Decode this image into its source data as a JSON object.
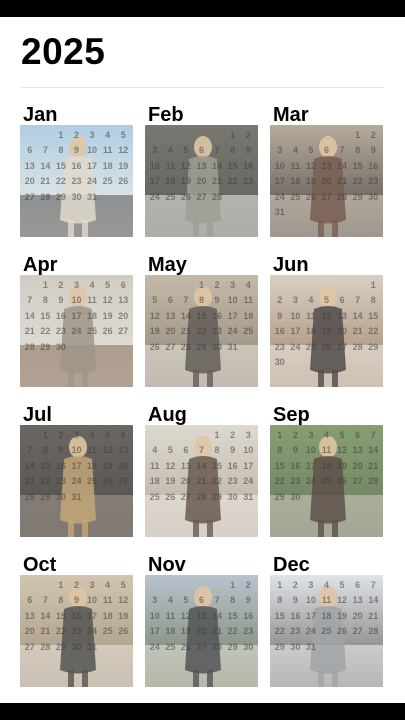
{
  "header": {
    "year": "2025"
  },
  "months": [
    {
      "name": "Jan",
      "offset": 2,
      "days": 31,
      "colors": [
        "#9fc3dc",
        "#d9d1c2",
        "#2a2a2a",
        "#f0ece4"
      ]
    },
    {
      "name": "Feb",
      "offset": 5,
      "days": 28,
      "colors": [
        "#5b5a52",
        "#8b8a7c",
        "#efece6",
        "#3b3a35"
      ]
    },
    {
      "name": "Mar",
      "offset": 5,
      "days": 31,
      "colors": [
        "#a69a88",
        "#5b3b2c",
        "#d9cdbb",
        "#2d2420"
      ]
    },
    {
      "name": "Apr",
      "offset": 1,
      "days": 30,
      "colors": [
        "#c7c2b6",
        "#8a7e6e",
        "#6e4b32",
        "#e0ddd5"
      ]
    },
    {
      "name": "May",
      "offset": 3,
      "days": 31,
      "colors": [
        "#b7aa95",
        "#3f3a34",
        "#e7e2d8",
        "#7a6d5c"
      ]
    },
    {
      "name": "Jun",
      "offset": 6,
      "days": 30,
      "colors": [
        "#cfc6b6",
        "#2b2623",
        "#f1efe9",
        "#8f6b4c"
      ]
    },
    {
      "name": "Jul",
      "offset": 1,
      "days": 31,
      "colors": [
        "#4b4640",
        "#b7935c",
        "#8f8778",
        "#2e2a26"
      ]
    },
    {
      "name": "Aug",
      "offset": 4,
      "days": 31,
      "colors": [
        "#d7d2c7",
        "#4a3628",
        "#eeeae3",
        "#a49a88"
      ]
    },
    {
      "name": "Sep",
      "offset": 0,
      "days": 30,
      "colors": [
        "#6e8a56",
        "#3b2a22",
        "#c8c2b5",
        "#4b5e3a"
      ]
    },
    {
      "name": "Oct",
      "offset": 2,
      "days": 31,
      "colors": [
        "#c9b99f",
        "#2f2f2c",
        "#e8e2d8",
        "#8e7c63"
      ]
    },
    {
      "name": "Nov",
      "offset": 5,
      "days": 30,
      "colors": [
        "#a9b6c4",
        "#2e3033",
        "#e7e4df",
        "#55643f"
      ]
    },
    {
      "name": "Dec",
      "offset": 0,
      "days": 31,
      "colors": [
        "#d9dde2",
        "#8c8f93",
        "#f6f6f6",
        "#4a4744"
      ]
    }
  ]
}
